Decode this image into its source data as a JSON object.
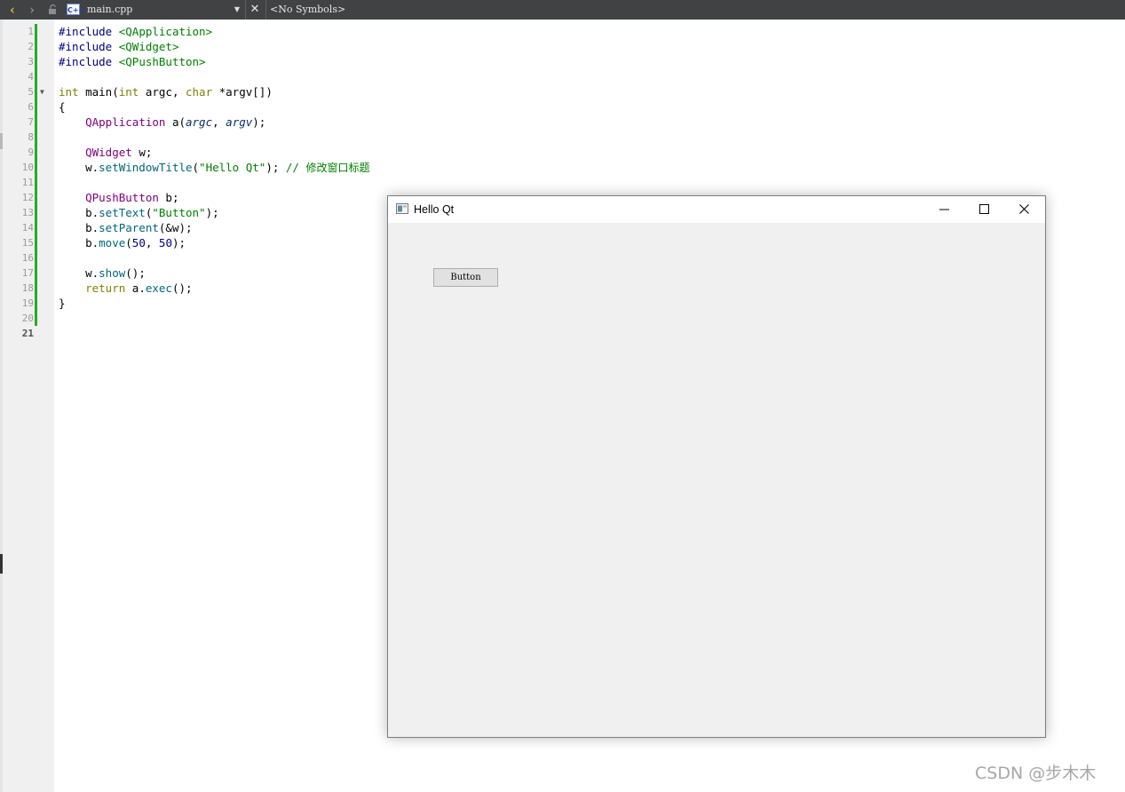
{
  "toolbar": {
    "file_name": "main.cpp",
    "file_badge": "C++",
    "symbols": "<No Symbols>"
  },
  "editor": {
    "line_numbers": [
      "1",
      "2",
      "3",
      "4",
      "5",
      "6",
      "7",
      "8",
      "9",
      "10",
      "11",
      "12",
      "13",
      "14",
      "15",
      "16",
      "17",
      "18",
      "19",
      "20",
      "21"
    ],
    "current_line": "21",
    "code_lines": [
      "#include <QApplication>",
      "#include <QWidget>",
      "#include <QPushButton>",
      "",
      "int main(int argc, char *argv[])",
      "{",
      "    QApplication a(argc, argv);",
      "",
      "    QWidget w;",
      "    w.setWindowTitle(\"Hello Qt\"); // 修改窗口标题",
      "",
      "    QPushButton b;",
      "    b.setText(\"Button\");",
      "    b.setParent(&w);",
      "    b.move(50, 50);",
      "",
      "    w.show();",
      "    return a.exec();",
      "}",
      "",
      ""
    ]
  },
  "qt_window": {
    "title": "Hello Qt",
    "button_label": "Button"
  },
  "watermark": "CSDN @步木木",
  "colors": {
    "toolbar_bg": "#404244",
    "change_bar": "#2aa82a",
    "keyword": "#808000",
    "type": "#800080",
    "string": "#008000"
  }
}
